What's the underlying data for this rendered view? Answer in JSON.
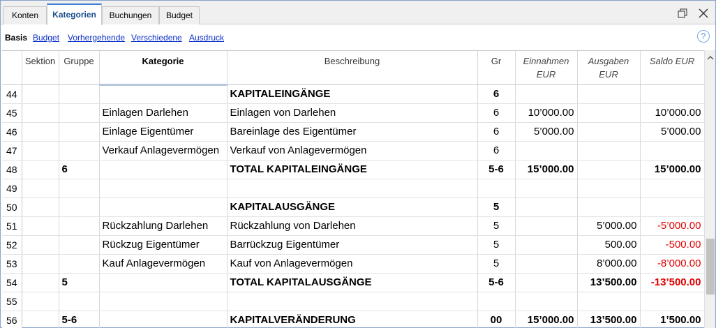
{
  "tabs": [
    {
      "label": "Konten",
      "active": false
    },
    {
      "label": "Kategorien",
      "active": true
    },
    {
      "label": "Buchungen",
      "active": false
    },
    {
      "label": "Budget",
      "active": false
    }
  ],
  "window_controls": {
    "restore_icon": "restore-window-icon",
    "close_icon": "close-icon"
  },
  "subnav": {
    "active": "Basis",
    "links": [
      "Budget",
      "Vorhergehende",
      "Verschiedene",
      "Ausdruck"
    ],
    "help_icon": "help-icon",
    "help_glyph": "?"
  },
  "columns": {
    "rownum": "",
    "sektion": "Sektion",
    "gruppe": "Gruppe",
    "kategorie": "Kategorie",
    "beschreibung": "Beschreibung",
    "gr": "Gr",
    "einnahmen": [
      "Einnahmen",
      "EUR"
    ],
    "ausgaben": [
      "Ausgaben",
      "EUR"
    ],
    "saldo": "Saldo EUR"
  },
  "rows": [
    {
      "n": "44",
      "sektion": "",
      "gruppe": "",
      "kategorie": "",
      "beschreibung": "KAPITALEINGÄNGE",
      "gr": "6",
      "einnahmen": "",
      "ausgaben": "",
      "saldo": "",
      "bold": true,
      "neg": false
    },
    {
      "n": "45",
      "sektion": "",
      "gruppe": "",
      "kategorie": "Einlagen Darlehen",
      "beschreibung": "Einlagen von Darlehen",
      "gr": "6",
      "einnahmen": "10’000.00",
      "ausgaben": "",
      "saldo": "10’000.00",
      "bold": false,
      "neg": false
    },
    {
      "n": "46",
      "sektion": "",
      "gruppe": "",
      "kategorie": "Einlage Eigentümer",
      "beschreibung": "Bareinlage des Eigentümer",
      "gr": "6",
      "einnahmen": "5’000.00",
      "ausgaben": "",
      "saldo": "5’000.00",
      "bold": false,
      "neg": false
    },
    {
      "n": "47",
      "sektion": "",
      "gruppe": "",
      "kategorie": "Verkauf Anlagevermögen",
      "beschreibung": "Verkauf von Anlagevermögen",
      "gr": "6",
      "einnahmen": "",
      "ausgaben": "",
      "saldo": "",
      "bold": false,
      "neg": false
    },
    {
      "n": "48",
      "sektion": "",
      "gruppe": "6",
      "kategorie": "",
      "beschreibung": "TOTAL KAPITALEINGÄNGE",
      "gr": "5-6",
      "einnahmen": "15’000.00",
      "ausgaben": "",
      "saldo": "15’000.00",
      "bold": true,
      "neg": false
    },
    {
      "n": "49",
      "sektion": "",
      "gruppe": "",
      "kategorie": "",
      "beschreibung": "",
      "gr": "",
      "einnahmen": "",
      "ausgaben": "",
      "saldo": "",
      "bold": false,
      "neg": false
    },
    {
      "n": "50",
      "sektion": "",
      "gruppe": "",
      "kategorie": "",
      "beschreibung": "KAPITALAUSGÄNGE",
      "gr": "5",
      "einnahmen": "",
      "ausgaben": "",
      "saldo": "",
      "bold": true,
      "neg": false
    },
    {
      "n": "51",
      "sektion": "",
      "gruppe": "",
      "kategorie": "Rückzahlung Darlehen",
      "beschreibung": "Rückzahlung von Darlehen",
      "gr": "5",
      "einnahmen": "",
      "ausgaben": "5’000.00",
      "saldo": "-5’000.00",
      "bold": false,
      "neg": true
    },
    {
      "n": "52",
      "sektion": "",
      "gruppe": "",
      "kategorie": "Rückzug Eigentümer",
      "beschreibung": "Barrückzug Eigentümer",
      "gr": "5",
      "einnahmen": "",
      "ausgaben": "500.00",
      "saldo": "-500.00",
      "bold": false,
      "neg": true
    },
    {
      "n": "53",
      "sektion": "",
      "gruppe": "",
      "kategorie": "Kauf Anlagevermögen",
      "beschreibung": "Kauf von Anlagevermögen",
      "gr": "5",
      "einnahmen": "",
      "ausgaben": "8’000.00",
      "saldo": "-8’000.00",
      "bold": false,
      "neg": true
    },
    {
      "n": "54",
      "sektion": "",
      "gruppe": "5",
      "kategorie": "",
      "beschreibung": "TOTAL KAPITALAUSGÄNGE",
      "gr": "5-6",
      "einnahmen": "",
      "ausgaben": "13’500.00",
      "saldo": "-13’500.00",
      "bold": true,
      "neg": true
    },
    {
      "n": "55",
      "sektion": "",
      "gruppe": "",
      "kategorie": "",
      "beschreibung": "",
      "gr": "",
      "einnahmen": "",
      "ausgaben": "",
      "saldo": "",
      "bold": false,
      "neg": false
    },
    {
      "n": "56",
      "sektion": "",
      "gruppe": "5-6",
      "kategorie": "",
      "beschreibung": "KAPITALVERÄNDERUNG",
      "gr": "00",
      "einnahmen": "15’000.00",
      "ausgaben": "13’500.00",
      "saldo": "1’500.00",
      "bold": true,
      "neg": false
    }
  ],
  "colors": {
    "negative": "#e00000",
    "link": "#0a2fc9",
    "active_tab": "#1a4f8c"
  }
}
